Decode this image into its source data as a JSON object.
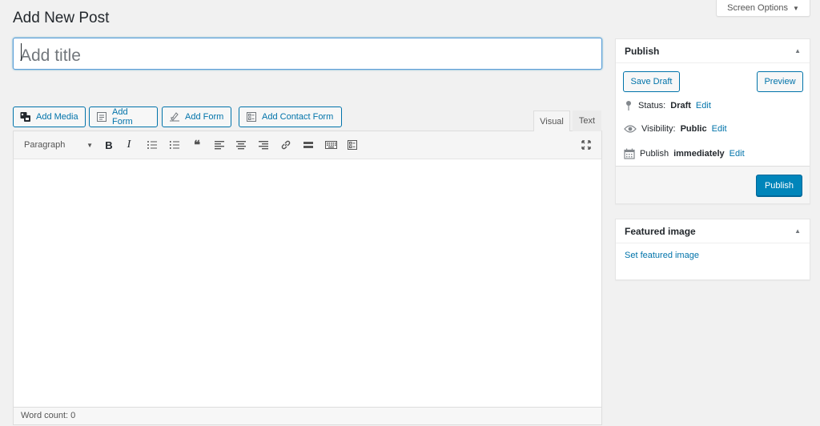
{
  "page": {
    "title": "Add New Post"
  },
  "screen_options": {
    "label": "Screen Options"
  },
  "title_field": {
    "placeholder": "Add title",
    "value": ""
  },
  "media_buttons": [
    {
      "label": "Add Media",
      "icon": "add-media-icon"
    },
    {
      "label": "Add Form",
      "icon": "form-icon"
    },
    {
      "label": "Add Form",
      "icon": "form-pencil-icon"
    },
    {
      "label": "Add Contact Form",
      "icon": "contact-form-icon"
    }
  ],
  "editor_tabs": {
    "visual": "Visual",
    "text": "Text",
    "active": "Visual"
  },
  "toolbar": {
    "format_value": "Paragraph",
    "buttons": [
      "bold",
      "italic",
      "bulleted-list",
      "numbered-list",
      "blockquote",
      "align-left",
      "align-center",
      "align-right",
      "insert-link",
      "read-more",
      "toolbar-toggle",
      "form",
      "distraction-free"
    ]
  },
  "status_bar": {
    "word_count": "Word count: 0"
  },
  "publish": {
    "heading": "Publish",
    "save_draft": "Save Draft",
    "preview": "Preview",
    "status_label": "Status:",
    "status_value": "Draft",
    "visibility_label": "Visibility:",
    "visibility_value": "Public",
    "publish_label": "Publish",
    "publish_value": "immediately",
    "edit_link": "Edit",
    "publish_button": "Publish"
  },
  "featured_image": {
    "heading": "Featured image",
    "link": "Set featured image"
  },
  "colors": {
    "accent": "#0073aa",
    "primary_button": "#0085ba",
    "background": "#f1f1f1"
  }
}
